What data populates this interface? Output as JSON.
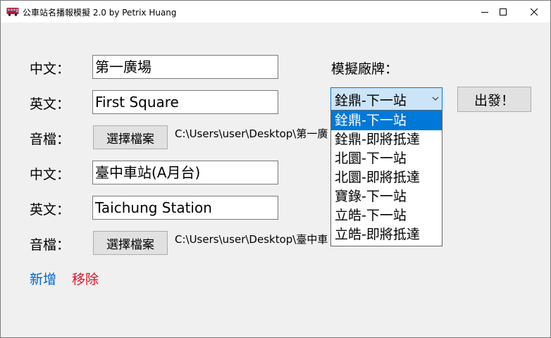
{
  "window": {
    "title": "公車站名播報模擬 2.0  by Petrix Huang"
  },
  "stations": [
    {
      "zh_label": "中文：",
      "zh_value": "第一廣場",
      "en_label": "英文：",
      "en_value": "First Square",
      "audio_label": "音檔：",
      "audio_button": "選擇檔案",
      "audio_path": "C:\\Users\\user\\Desktop\\第一廣"
    },
    {
      "zh_label": "中文：",
      "zh_value": "臺中車站(A月台)",
      "en_label": "英文：",
      "en_value": "Taichung Station",
      "audio_label": "音檔：",
      "audio_button": "選擇檔案",
      "audio_path": "C:\\Users\\user\\Desktop\\臺中車"
    }
  ],
  "actions": {
    "add_label": "新增",
    "remove_label": "移除",
    "add_color": "#0066cc",
    "remove_color": "#e81123"
  },
  "vendor": {
    "label": "模擬廠牌：",
    "selected": "銓鼎-下一站",
    "options": [
      "銓鼎-下一站",
      "銓鼎-即將抵達",
      "北圜-下一站",
      "北圜-即將抵達",
      "寶錄-下一站",
      "立皓-下一站",
      "立皓-即將抵達"
    ],
    "highlighted_index": 0
  },
  "go_button": "出發！",
  "colors": {
    "accent": "#0078d7",
    "combo_bg": "#cce4f7"
  }
}
